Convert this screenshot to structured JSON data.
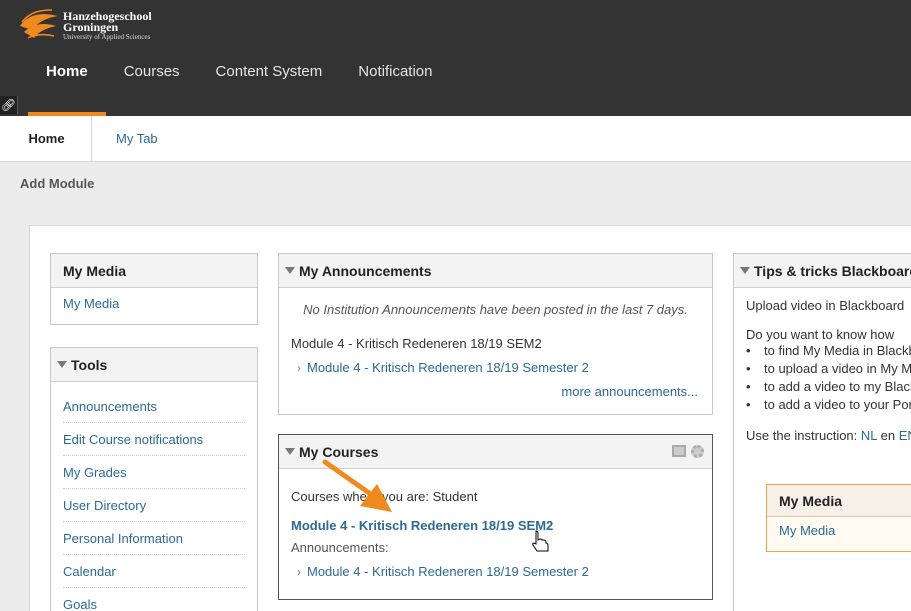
{
  "header": {
    "logo": {
      "line1": "Hanzehogeschool",
      "line2": "Groningen",
      "line3": "University of Applied Sciences"
    },
    "nav": [
      "Home",
      "Courses",
      "Content System",
      "Notification"
    ],
    "active_nav": "Home"
  },
  "tabs": [
    "Home",
    "My Tab"
  ],
  "add_module": "Add Module",
  "my_media": {
    "title": "My Media",
    "link": "My Media"
  },
  "tools": {
    "title": "Tools",
    "items": [
      "Announcements",
      "Edit Course notifications",
      "My Grades",
      "User Directory",
      "Personal Information",
      "Calendar",
      "Goals"
    ]
  },
  "announcements": {
    "title": "My Announcements",
    "empty_notice": "No Institution Announcements have been posted in the last 7 days.",
    "course_name": "Module 4 - Kritisch Redeneren 18/19 SEM2",
    "item_link": "Module 4 - Kritisch Redeneren 18/19 Semester 2",
    "more": "more announcements..."
  },
  "courses": {
    "title": "My Courses",
    "role_text": "Courses where you are: Student",
    "course_link": "Module 4 - Kritisch Redeneren 18/19 SEM2",
    "announcements_label": "Announcements:",
    "ann_link": "Module 4 - Kritisch Redeneren 18/19 Semester 2"
  },
  "tips": {
    "title": "Tips & tricks Blackboard",
    "intro": "Upload video in Blackboard",
    "question": "Do you want to know how",
    "bullets": [
      "to find My Media in Blackboard",
      "to upload a video in My Media",
      "to add a video to my Blackboard",
      "to add a video to your Portfolio"
    ],
    "instruction_prefix": "Use the instruction: ",
    "instruction_nl": "NL",
    "instruction_mid": " en ",
    "instruction_en": "EN",
    "inner_title": "My Media",
    "inner_link": "My Media"
  },
  "colors": {
    "accent": "#f08a1e",
    "link": "#2b6a97",
    "topbar": "#333333"
  }
}
